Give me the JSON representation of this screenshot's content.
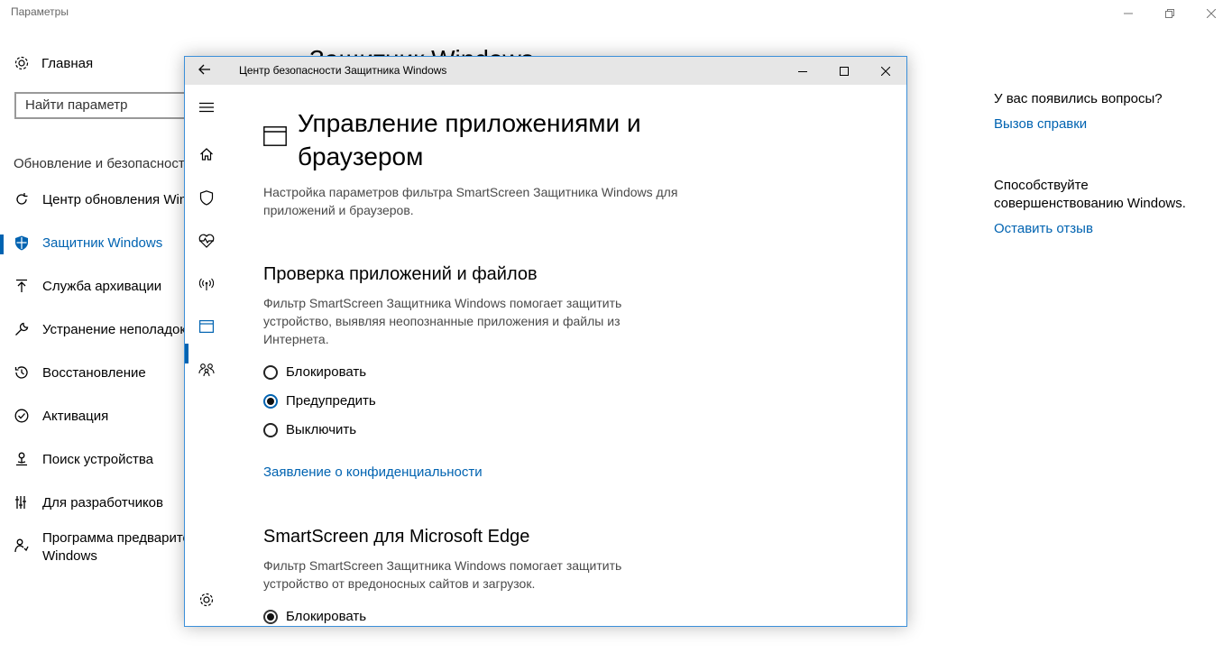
{
  "bg_window": {
    "title": "Параметры",
    "home_label": "Главная",
    "search_placeholder": "Найти параметр",
    "section_header": "Обновление и безопасность",
    "page_title_partial": "Защитник Windows",
    "nav_items": [
      {
        "label": "Центр обновления Windows",
        "icon": "refresh-icon"
      },
      {
        "label": "Защитник Windows",
        "icon": "shield-icon",
        "active": true
      },
      {
        "label": "Служба архивации",
        "icon": "upload-icon"
      },
      {
        "label": "Устранение неполадок",
        "icon": "wrench-icon"
      },
      {
        "label": "Восстановление",
        "icon": "history-icon"
      },
      {
        "label": "Активация",
        "icon": "check-circle-icon"
      },
      {
        "label": "Поиск устройства",
        "icon": "person-location-icon"
      },
      {
        "label": "Для разработчиков",
        "icon": "developer-icon"
      },
      {
        "label": "Программа предварительной оценки Windows",
        "label_line2": "Windows",
        "icon": "insider-icon"
      }
    ],
    "help": {
      "question": "У вас появились вопросы?",
      "help_link": "Вызов справки",
      "feedback_text": "Способствуйте совершенствованию Windows.",
      "feedback_link": "Оставить отзыв"
    }
  },
  "defender": {
    "title": "Центр безопасности Защитника Windows",
    "page_title": "Управление приложениями и браузером",
    "page_desc": "Настройка параметров фильтра SmartScreen Защитника Windows для приложений и браузеров.",
    "section1": {
      "title": "Проверка приложений и файлов",
      "desc": "Фильтр SmartScreen Защитника Windows помогает защитить устройство, выявляя неопознанные приложения и файлы из Интернета.",
      "options": [
        "Блокировать",
        "Предупредить",
        "Выключить"
      ],
      "selected": "Предупредить"
    },
    "privacy_link": "Заявление о конфиденциальности",
    "section2": {
      "title": "SmartScreen для Microsoft Edge",
      "desc": "Фильтр SmartScreen Защитника Windows помогает защитить устройство от вредоносных сайтов и загрузок.",
      "options": [
        "Блокировать"
      ],
      "selected": "Блокировать"
    }
  },
  "colors": {
    "accent": "#0063b1",
    "titlebar": "#e6e6e6",
    "border": "#3b8fd9"
  }
}
